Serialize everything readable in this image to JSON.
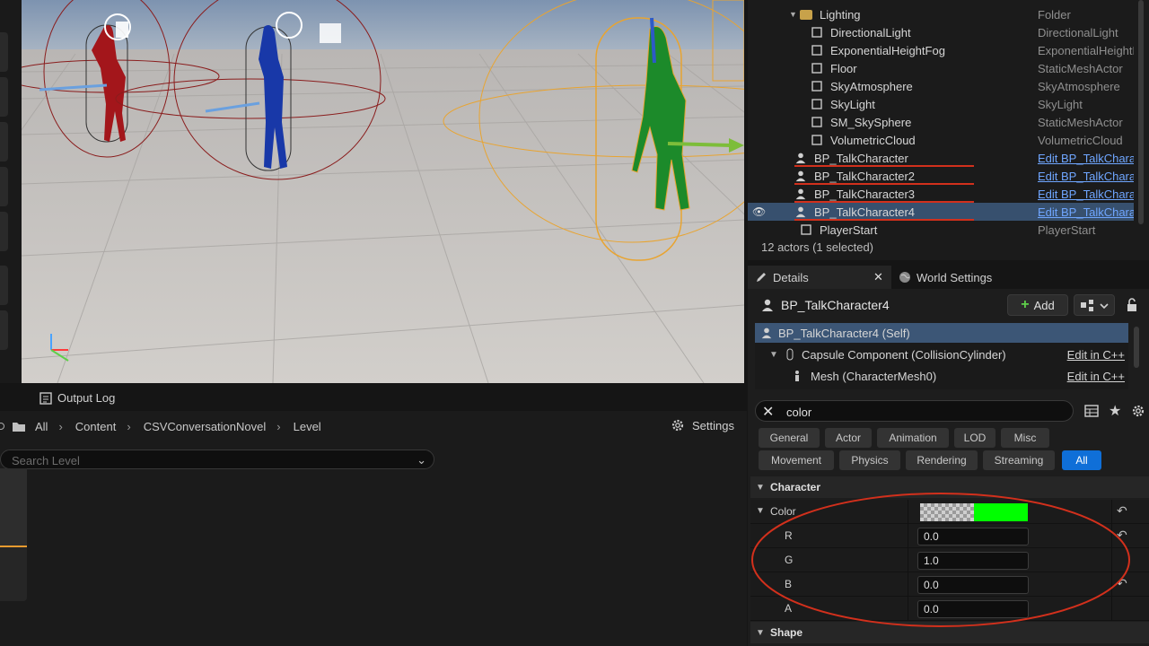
{
  "outliner": {
    "rows": [
      {
        "label": "Lighting",
        "type": "Folder",
        "icon": "folder-icon"
      },
      {
        "label": "DirectionalLight",
        "type": "DirectionalLight",
        "icon": "directional-light-icon"
      },
      {
        "label": "ExponentialHeightFog",
        "type": "ExponentialHeightF",
        "icon": "fog-icon"
      },
      {
        "label": "Floor",
        "type": "StaticMeshActor",
        "icon": "static-mesh-icon"
      },
      {
        "label": "SkyAtmosphere",
        "type": "SkyAtmosphere",
        "icon": "sky-atmosphere-icon"
      },
      {
        "label": "SkyLight",
        "type": "SkyLight",
        "icon": "sky-light-icon"
      },
      {
        "label": "SM_SkySphere",
        "type": "StaticMeshActor",
        "icon": "static-mesh-icon"
      },
      {
        "label": "VolumetricCloud",
        "type": "VolumetricCloud",
        "icon": "cloud-icon"
      },
      {
        "label": "BP_TalkCharacter",
        "type": "Edit BP_TalkChara",
        "icon": "character-icon"
      },
      {
        "label": "BP_TalkCharacter2",
        "type": "Edit BP_TalkChara",
        "icon": "character-icon"
      },
      {
        "label": "BP_TalkCharacter3",
        "type": "Edit BP_TalkChara",
        "icon": "character-icon"
      },
      {
        "label": "BP_TalkCharacter4",
        "type": "Edit BP_TalkChara",
        "icon": "character-icon"
      },
      {
        "label": "PlayerStart",
        "type": "PlayerStart",
        "icon": "player-start-icon"
      }
    ],
    "actor_count": "12 actors (1 selected)"
  },
  "bottom": {
    "output_log_label": "Output Log",
    "breadcrumbs": [
      "All",
      "Content",
      "CSVConversationNovel",
      "Level"
    ],
    "settings_label": "Settings",
    "search_placeholder": "Search Level"
  },
  "details": {
    "tab_details": "Details",
    "tab_world_settings": "World Settings",
    "actor_name": "BP_TalkCharacter4",
    "add_label": "Add",
    "components": [
      {
        "label": "BP_TalkCharacter4 (Self)",
        "link": ""
      },
      {
        "label": "Capsule Component (CollisionCylinder)",
        "link": "Edit in C++"
      },
      {
        "label": "Mesh (CharacterMesh0)",
        "link": "Edit in C++"
      }
    ],
    "filter_value": "color",
    "categories_row1": [
      "General",
      "Actor",
      "Animation",
      "LOD",
      "Misc"
    ],
    "categories_row2": [
      "Movement",
      "Physics",
      "Rendering",
      "Streaming",
      "All"
    ],
    "active_category": "All",
    "section_character": "Character",
    "color_label": "Color",
    "color_swatch": "#00ff00",
    "channels": [
      {
        "name": "R",
        "value": "0.0"
      },
      {
        "name": "G",
        "value": "1.0"
      },
      {
        "name": "B",
        "value": "0.0"
      },
      {
        "name": "A",
        "value": "0.0"
      }
    ],
    "section_shape": "Shape"
  },
  "colors": {
    "selection": "#37506e",
    "accent_blue": "#0f6fd8",
    "annotation_red": "#d2301c",
    "link": "#6fa6ff"
  }
}
